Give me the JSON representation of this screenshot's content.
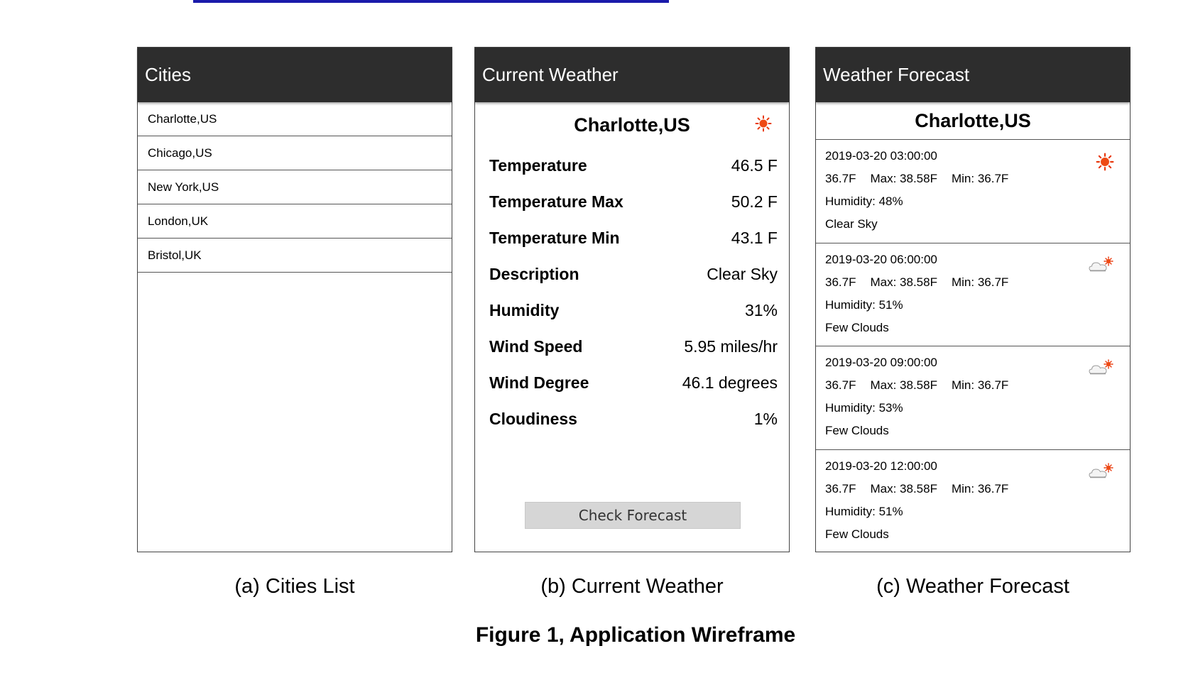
{
  "cities_panel": {
    "header": "Cities",
    "items": [
      "Charlotte,US",
      "Chicago,US",
      "New York,US",
      "London,UK",
      "Bristol,UK"
    ]
  },
  "current_panel": {
    "header": "Current Weather",
    "city": "Charlotte,US",
    "icon": "sun-icon",
    "rows": [
      {
        "label": "Temperature",
        "value": "46.5 F"
      },
      {
        "label": "Temperature Max",
        "value": "50.2 F"
      },
      {
        "label": "Temperature Min",
        "value": "43.1 F"
      },
      {
        "label": "Description",
        "value": "Clear Sky"
      },
      {
        "label": "Humidity",
        "value": "31%"
      },
      {
        "label": "Wind Speed",
        "value": "5.95 miles/hr"
      },
      {
        "label": "Wind Degree",
        "value": "46.1 degrees"
      },
      {
        "label": "Cloudiness",
        "value": "1%"
      }
    ],
    "button_label": "Check Forecast"
  },
  "forecast_panel": {
    "header": "Weather Forecast",
    "city": "Charlotte,US",
    "items": [
      {
        "datetime": "2019-03-20 03:00:00",
        "temp": "36.7F",
        "max": "Max: 38.58F",
        "min": "Min: 36.7F",
        "humidity": "Humidity: 48%",
        "description": "Clear Sky",
        "icon": "sun-icon"
      },
      {
        "datetime": "2019-03-20 06:00:00",
        "temp": "36.7F",
        "max": "Max: 38.58F",
        "min": "Min: 36.7F",
        "humidity": "Humidity: 51%",
        "description": "Few Clouds",
        "icon": "cloud-sun-icon"
      },
      {
        "datetime": "2019-03-20 09:00:00",
        "temp": "36.7F",
        "max": "Max: 38.58F",
        "min": "Min: 36.7F",
        "humidity": "Humidity: 53%",
        "description": "Few Clouds",
        "icon": "cloud-sun-icon"
      },
      {
        "datetime": "2019-03-20 12:00:00",
        "temp": "36.7F",
        "max": "Max: 38.58F",
        "min": "Min: 36.7F",
        "humidity": "Humidity: 51%",
        "description": "Few Clouds",
        "icon": "cloud-sun-icon"
      }
    ]
  },
  "captions": {
    "a": "(a) Cities List",
    "b": "(b) Current Weather",
    "c": "(c) Weather Forecast",
    "figure": "Figure 1, Application Wireframe"
  },
  "colors": {
    "header_bg": "#2d2d2d",
    "sun": "#e8380d",
    "link": "#1a1aaa"
  }
}
